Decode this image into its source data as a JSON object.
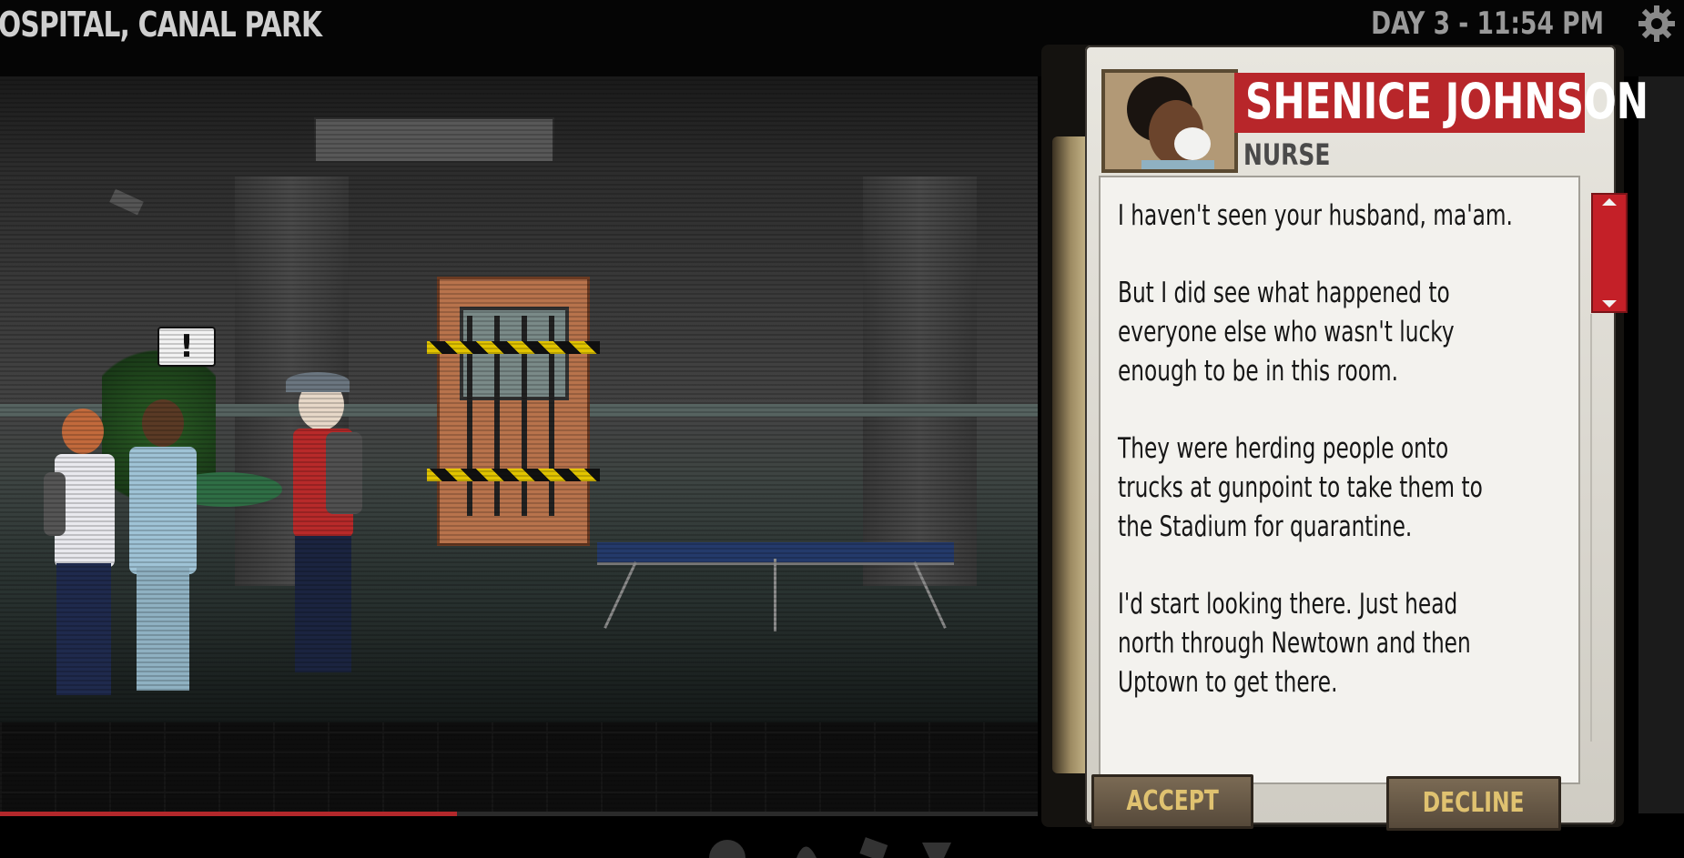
{
  "header": {
    "location": "OSPITAL, CANAL PARK",
    "time": "DAY 3 - 11:54 PM",
    "settings_icon": "gear-icon"
  },
  "scene": {
    "alert_glyph": "!",
    "progress": 0.44,
    "colors": {
      "progress": "#b3282b"
    }
  },
  "dialog": {
    "name": "SHENICE JOHNSON",
    "role": "NURSE",
    "paragraphs": [
      "I haven't seen your husband, ma'am.",
      "But I did see what happened to everyone else who wasn't lucky enough to be in this room.",
      "They were herding people onto trucks at gunpoint to take them to the Stadium for quarantine.",
      "I'd start looking there. Just head north through Newtown and then Uptown to get there."
    ],
    "lines": [
      [
        "I haven't seen your husband, ma'am."
      ],
      [
        "But I did see what happened to",
        "everyone else who wasn't lucky",
        "enough to be in this room."
      ],
      [
        "They were herding people onto",
        "trucks at gunpoint to take them to",
        "the Stadium for quarantine."
      ],
      [
        "I'd start looking there. Just head",
        "north through Newtown and then",
        "Uptown to get there."
      ]
    ],
    "accept_label": "ACCEPT",
    "decline_label": "DECLINE",
    "colors": {
      "banner": "#b8262a",
      "button_text": "#e0c270"
    }
  }
}
